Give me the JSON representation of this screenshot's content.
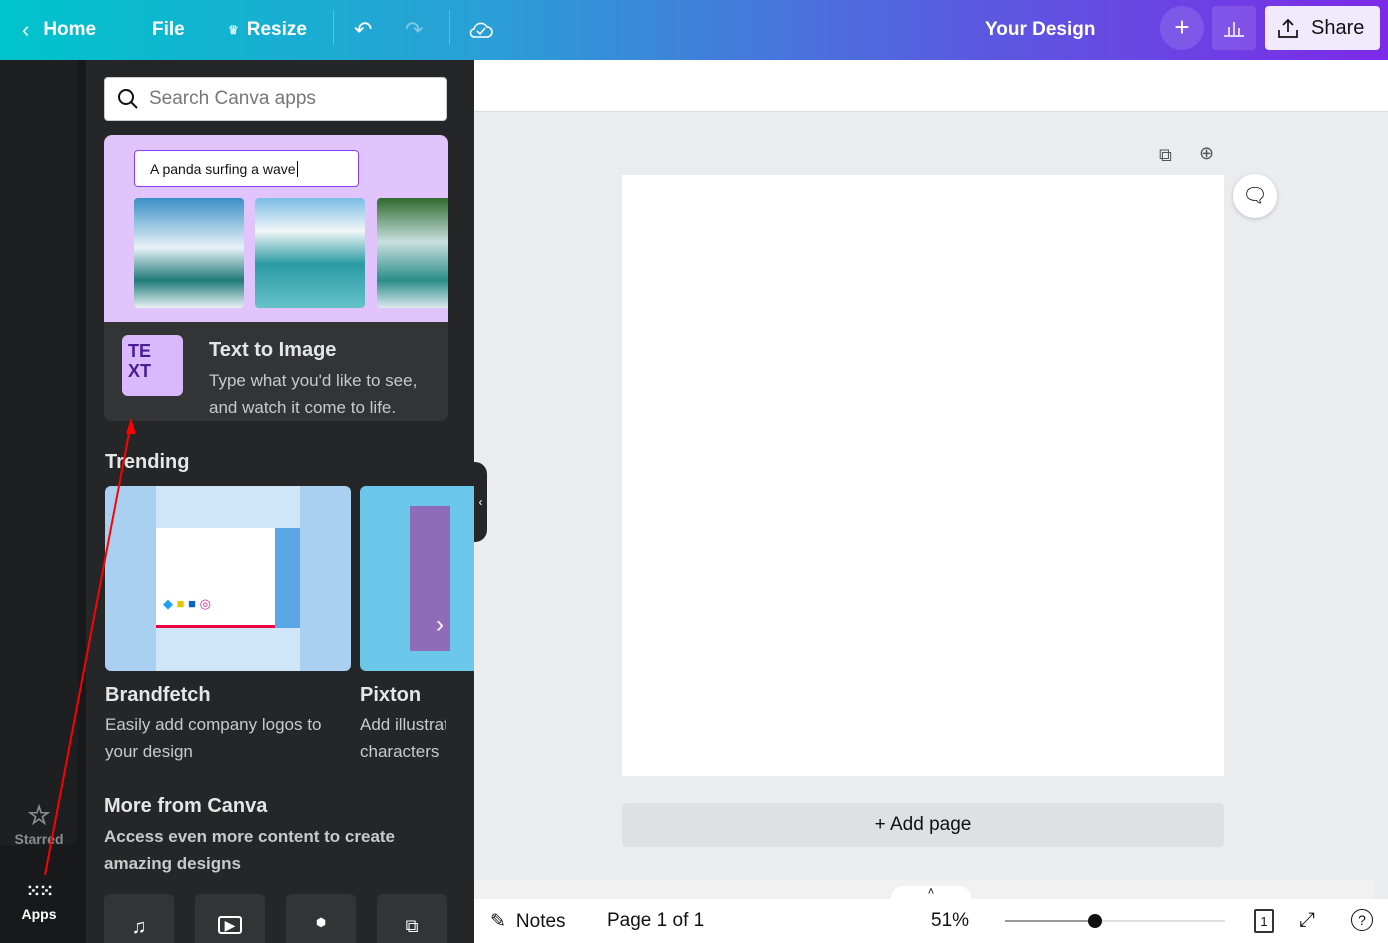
{
  "topbar": {
    "home": "Home",
    "file": "File",
    "resize": "Resize",
    "design_title": "Your Design",
    "share": "Share"
  },
  "rail": {
    "starred": "Starred",
    "apps": "Apps"
  },
  "panel": {
    "search_placeholder": "Search Canva apps",
    "featured": {
      "prompt": "A panda surfing a wave",
      "title": "Text to Image",
      "description_1": "Type what you'd like to see,",
      "description_2": "and watch it come to life."
    },
    "trending_heading": "Trending",
    "trending": [
      {
        "title": "Brandfetch",
        "desc_1": "Easily add company logos to",
        "desc_2": "your design"
      },
      {
        "title": "Pixton",
        "desc_1": "Add illustrated",
        "desc_2": "characters"
      }
    ],
    "more_heading": "More from Canva",
    "more_desc_1": "Access even more content to create",
    "more_desc_2": "amazing designs"
  },
  "canvas": {
    "add_page": "+ Add page"
  },
  "footer": {
    "notes": "Notes",
    "page_indicator": "Page 1 of 1",
    "zoom": "51%",
    "zoom_slider_fraction": 0.41,
    "page_count_badge": "1"
  },
  "colors": {
    "accent": "#8b3dff",
    "panel": "#252627",
    "annotation_arrow": "#ff0000"
  }
}
